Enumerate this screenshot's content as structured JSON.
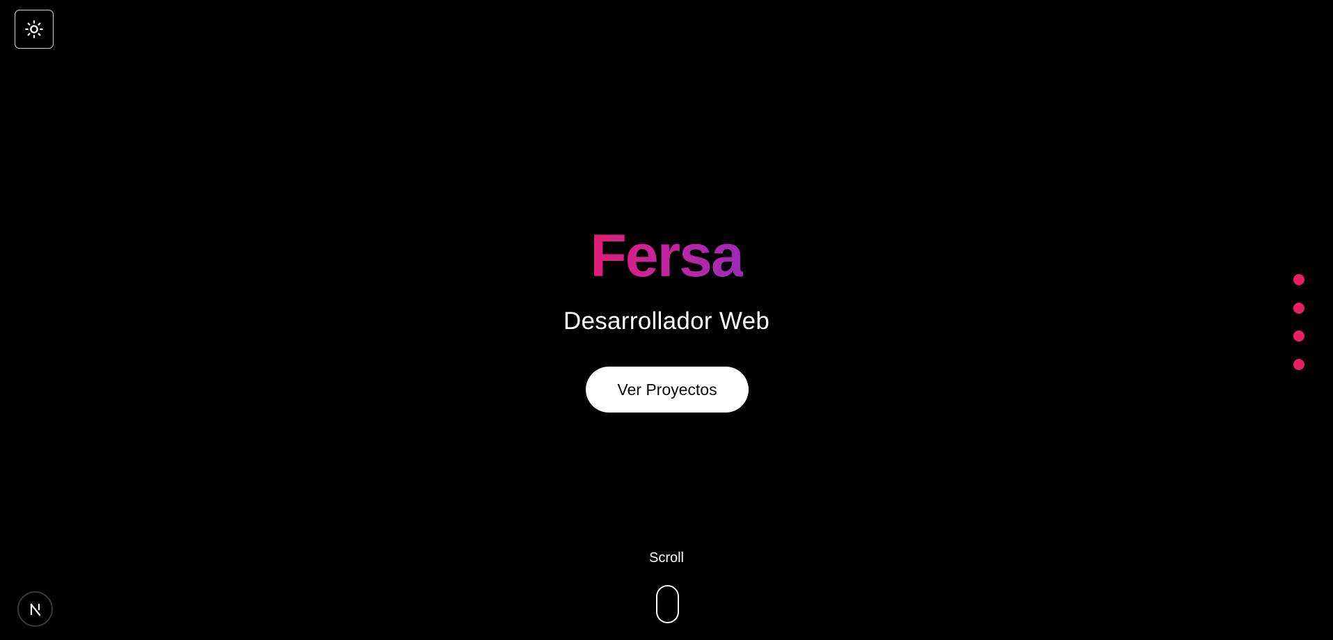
{
  "header": {
    "theme_toggle_icon": "sun-icon"
  },
  "hero": {
    "title": "Fersa",
    "subtitle": "Desarrollador Web",
    "cta_label": "Ver Proyectos"
  },
  "section_nav": {
    "dots": [
      {
        "index": 1
      },
      {
        "index": 2
      },
      {
        "index": 3
      },
      {
        "index": 4
      }
    ]
  },
  "scroll_indicator": {
    "label": "Scroll",
    "icon": "mouse-icon"
  },
  "badge": {
    "icon": "nextjs-icon"
  },
  "colors": {
    "background": "#000000",
    "accent": "#e91e63",
    "title_gradient_start": "#e11d74",
    "title_gradient_end": "#9b2bb8",
    "button_bg": "#ffffff",
    "text": "#ffffff"
  }
}
